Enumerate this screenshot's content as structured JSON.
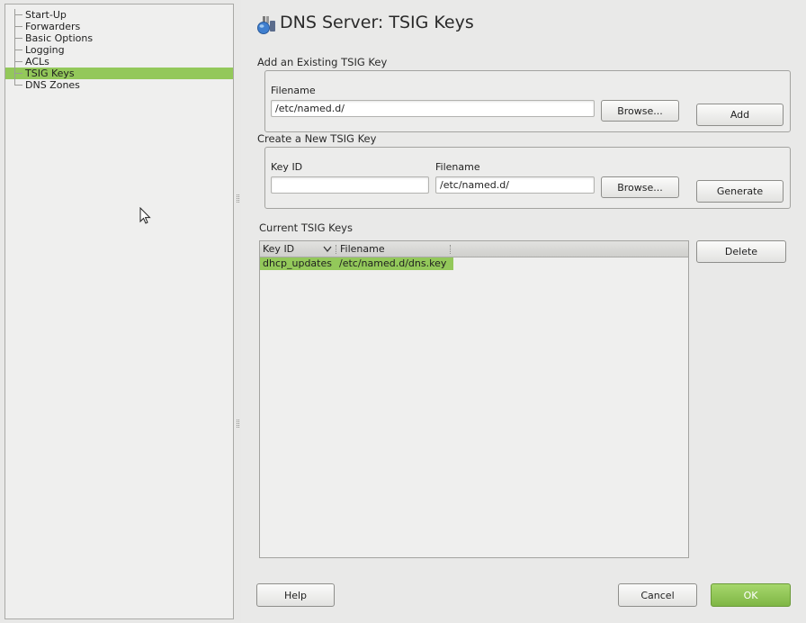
{
  "tree": {
    "items": [
      {
        "label": "Start-Up",
        "selected": false
      },
      {
        "label": "Forwarders",
        "selected": false
      },
      {
        "label": "Basic Options",
        "selected": false
      },
      {
        "label": "Logging",
        "selected": false
      },
      {
        "label": "ACLs",
        "selected": false
      },
      {
        "label": "TSIG Keys",
        "selected": true
      },
      {
        "label": "DNS Zones",
        "selected": false
      }
    ]
  },
  "page": {
    "title": "DNS Server: TSIG Keys",
    "icon": "dns-server-icon"
  },
  "add_existing": {
    "group_label": "Add an Existing TSIG Key",
    "filename_label": "Filename",
    "filename_value": "/etc/named.d/",
    "browse_label": "Browse...",
    "add_label": "Add"
  },
  "create_new": {
    "group_label": "Create a New TSIG Key",
    "key_id_label": "Key ID",
    "key_id_value": "",
    "filename_label": "Filename",
    "filename_value": "/etc/named.d/",
    "browse_label": "Browse...",
    "generate_label": "Generate"
  },
  "current_keys": {
    "group_label": "Current TSIG Keys",
    "columns": [
      "Key ID",
      "Filename"
    ],
    "rows": [
      {
        "key_id": "dhcp_updates",
        "filename": "/etc/named.d/dns.key",
        "selected": true
      }
    ],
    "delete_label": "Delete"
  },
  "footer": {
    "help_label": "Help",
    "cancel_label": "Cancel",
    "ok_label": "OK"
  },
  "colors": {
    "selection": "#93c85a",
    "ok_button": "#8cc452"
  }
}
